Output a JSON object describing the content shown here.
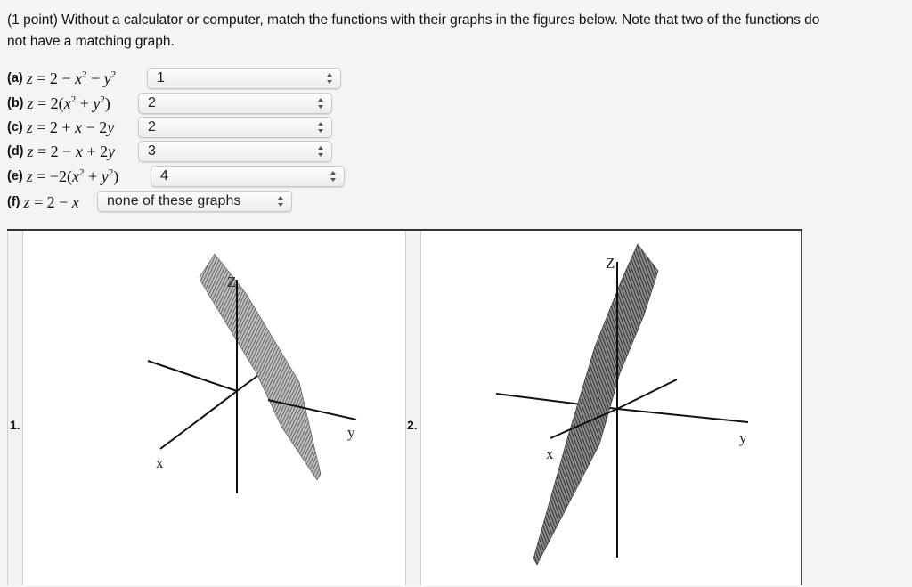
{
  "prompt": {
    "line1": "(1 point) Without a calculator or computer, match the functions with their graphs in the figures below. Note that two of the functions do",
    "line2": "not have a matching graph."
  },
  "questions": [
    {
      "label": "(a)",
      "equation": "z = 2 − x² − y²",
      "selected": "1"
    },
    {
      "label": "(b)",
      "equation": "z = 2(x² + y²)",
      "selected": "2"
    },
    {
      "label": "(c)",
      "equation": "z = 2 + x − 2y",
      "selected": "2"
    },
    {
      "label": "(d)",
      "equation": "z = 2 − x + 2y",
      "selected": "3"
    },
    {
      "label": "(e)",
      "equation": "z = −2(x² + y²)",
      "selected": "4"
    },
    {
      "label": "(f)",
      "equation": "z = 2 − x",
      "selected": "none of these graphs"
    }
  ],
  "figures": [
    {
      "label": "1.",
      "axes": {
        "x": "x",
        "y": "y",
        "z": "Z"
      }
    },
    {
      "label": "2.",
      "axes": {
        "x": "x",
        "y": "y",
        "z": "Z"
      }
    }
  ],
  "icons": {
    "select_arrows": "up-down-chevron-icon"
  }
}
